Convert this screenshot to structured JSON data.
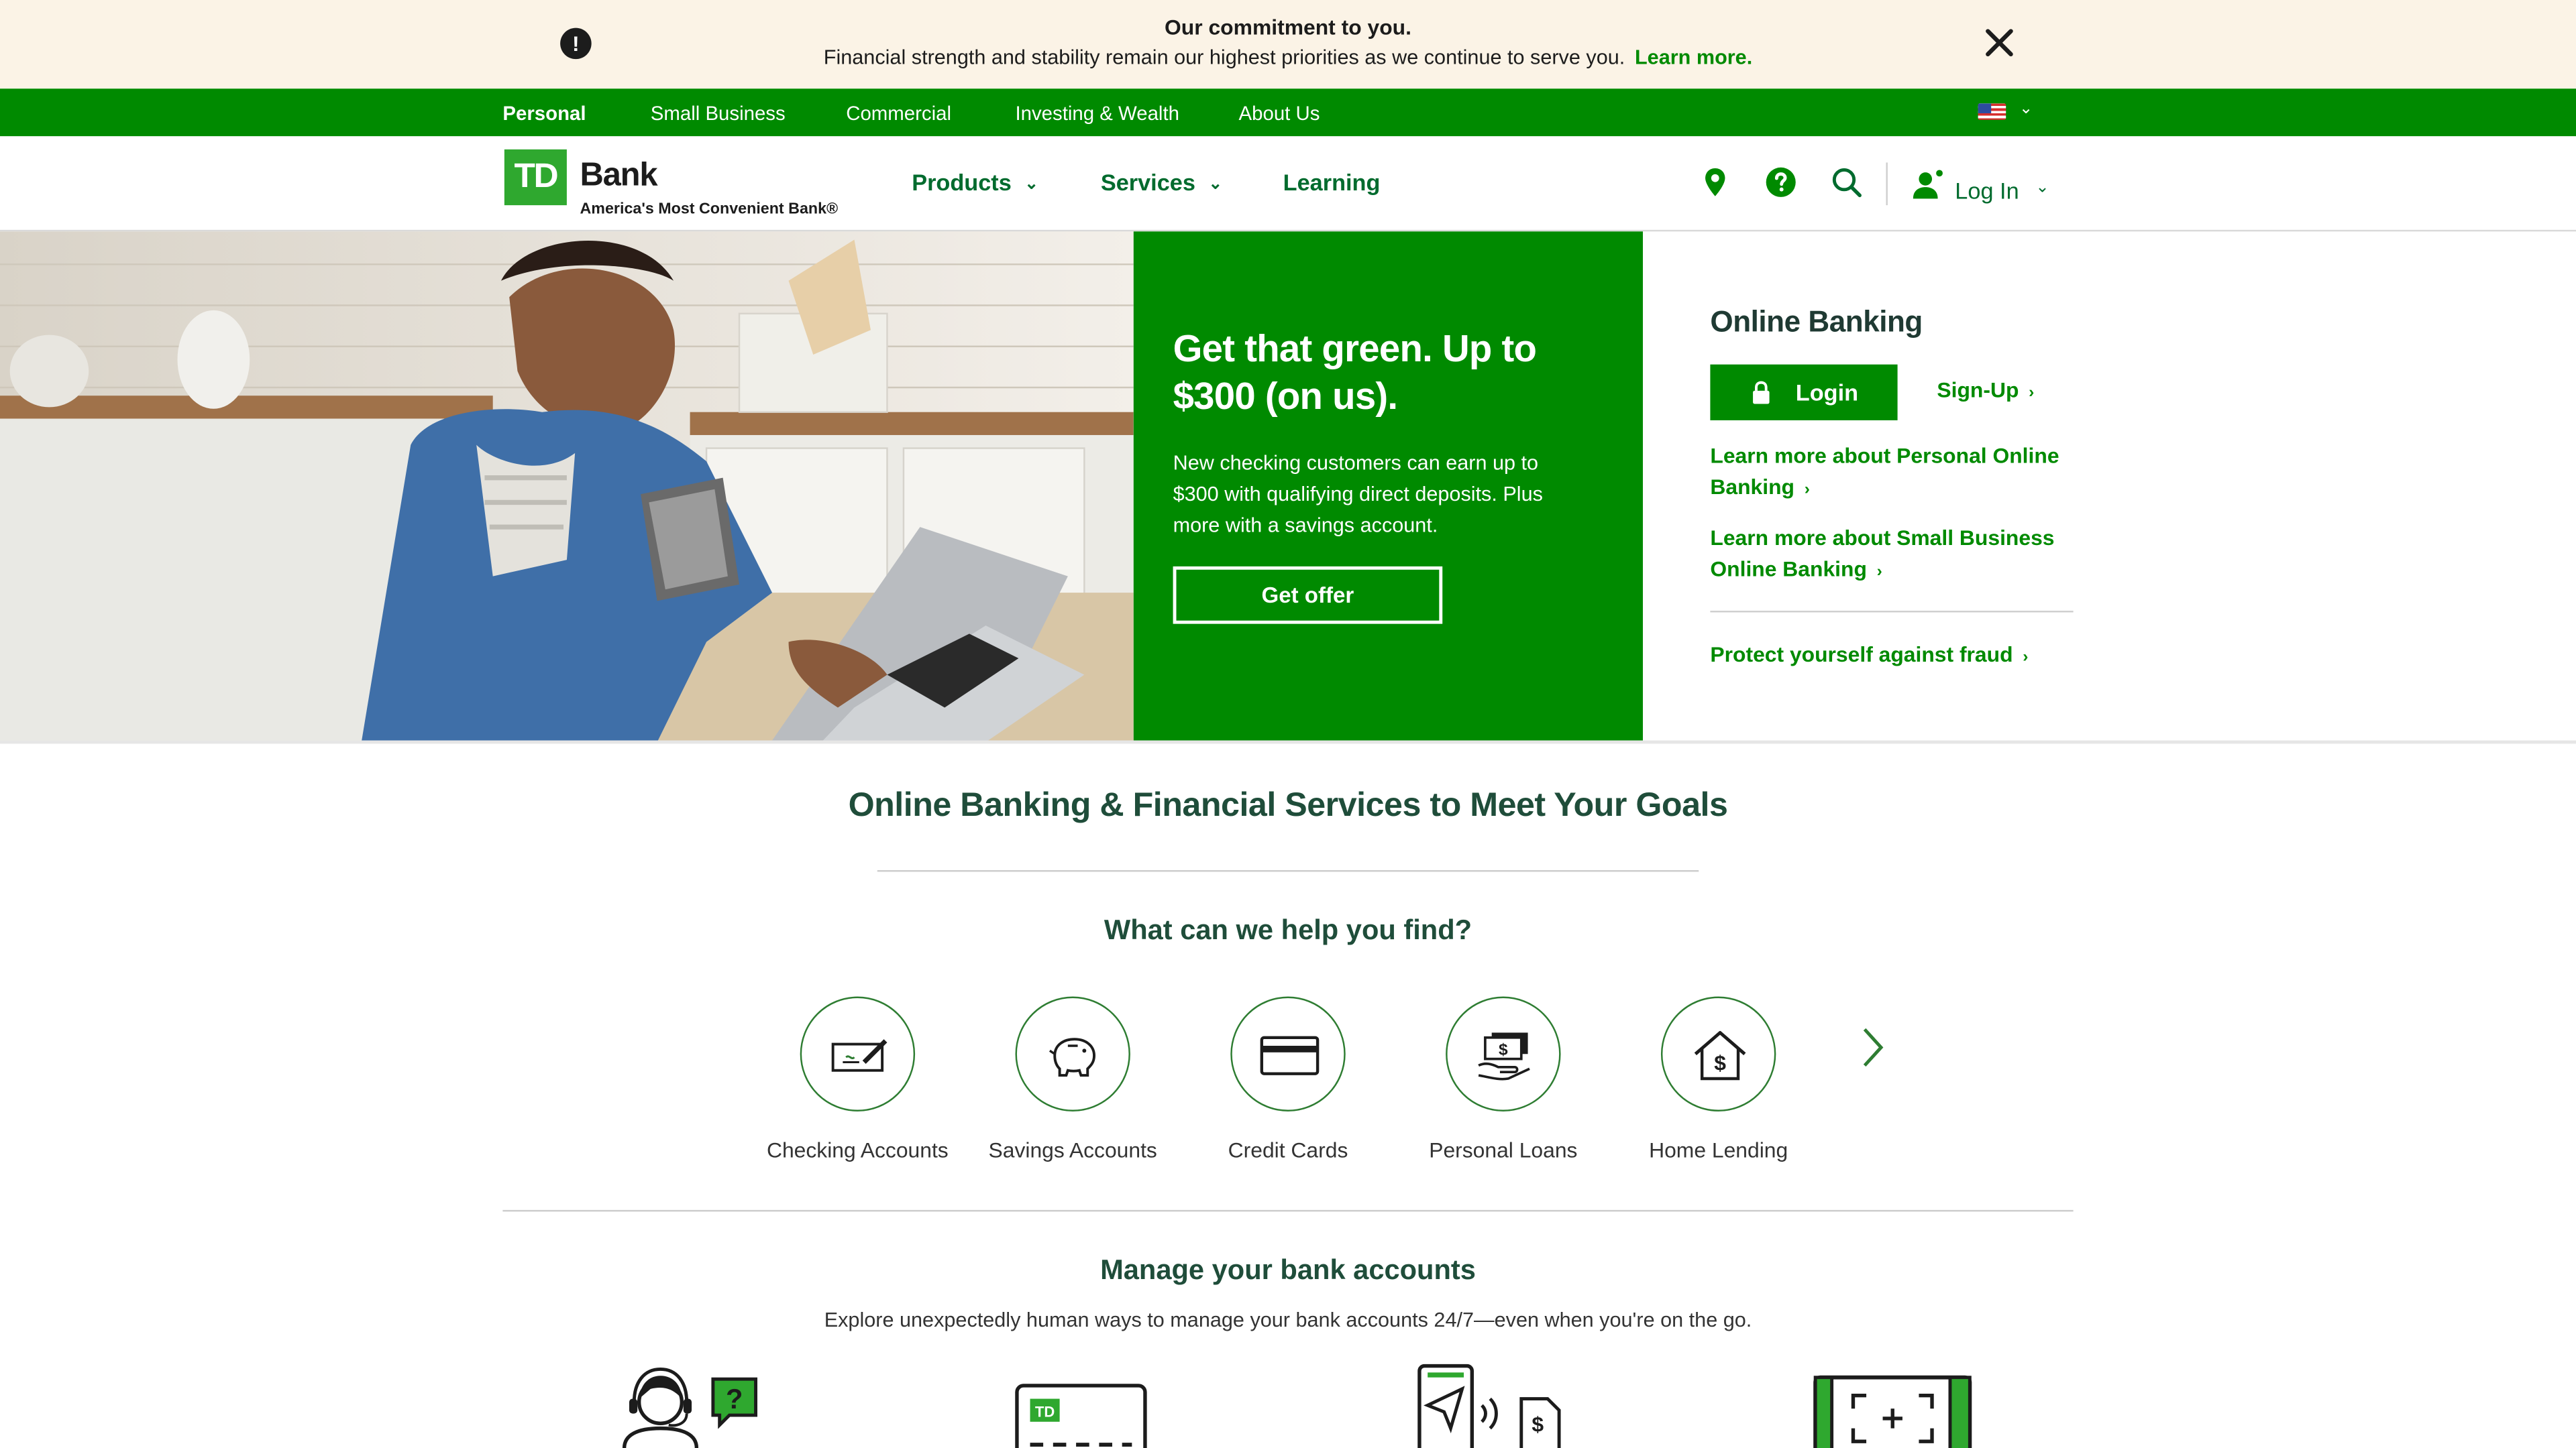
{
  "notice": {
    "icon": "alert-icon",
    "title": "Our commitment to you.",
    "text": "Financial strength and stability remain our highest priorities as we continue to serve you.",
    "link": "Learn more."
  },
  "topnav": {
    "items": [
      "Personal",
      "Small Business",
      "Commercial",
      "Investing & Wealth",
      "About Us"
    ],
    "active": "Personal",
    "locale_icon": "us-flag-icon"
  },
  "header": {
    "logo_mark": "TD",
    "logo_name": "Bank",
    "logo_tagline": "America's Most Convenient Bank®",
    "nav": [
      "Products",
      "Services",
      "Learning"
    ],
    "login": "Log In",
    "icons": [
      "location-icon",
      "help-icon",
      "search-icon",
      "user-icon"
    ]
  },
  "hero": {
    "title": "Get that green. Up to $300 (on us).",
    "body": "New checking customers can earn up to $300 with qualifying direct deposits. Plus more with a savings account.",
    "cta": "Get offer"
  },
  "online_banking": {
    "title": "Online Banking",
    "login": "Login",
    "signup": "Sign-Up",
    "personal_link": "Learn more about Personal Online Banking",
    "business_link": "Learn more about Small Business Online Banking",
    "fraud_link": "Protect yourself against fraud"
  },
  "main": {
    "title": "Online Banking & Financial Services to Meet Your Goals",
    "find_title": "What can we help you find?",
    "categories": [
      "Checking Accounts",
      "Savings Accounts",
      "Credit Cards",
      "Personal Loans",
      "Home Lending"
    ],
    "manage_title": "Manage your bank accounts",
    "manage_desc": "Explore unexpectedly human ways to manage your bank accounts 24/7—even when you're on the go."
  },
  "colors": {
    "brand_green": "#008a00",
    "dark_green": "#1f4d3a",
    "notice_bg": "#fbf3e6"
  }
}
